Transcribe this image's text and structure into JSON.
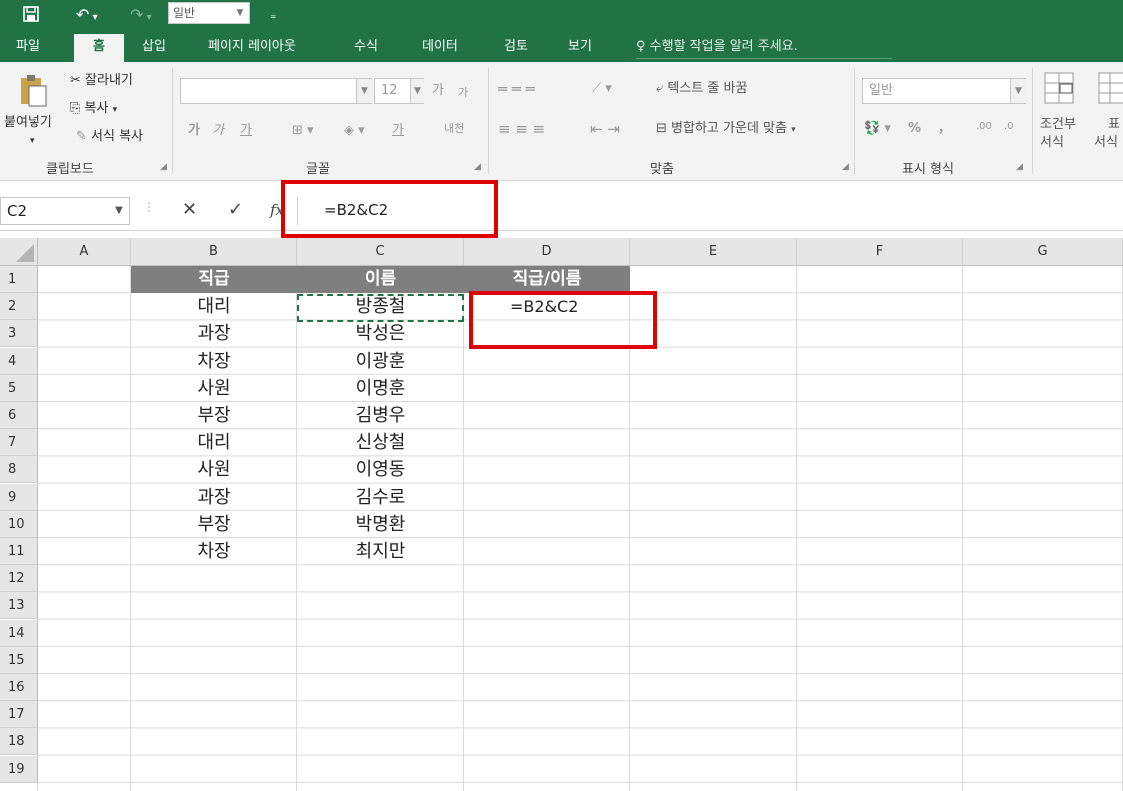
{
  "quick_access": {
    "font_box": "일반"
  },
  "tabs": [
    "파일",
    "홈",
    "삽입",
    "페이지 레이아웃",
    "수식",
    "데이터",
    "검토",
    "보기"
  ],
  "tell_me": "수행할 작업을 알려 주세요.",
  "ribbon": {
    "clipboard": {
      "cut": "잘라내기",
      "copy": "복사",
      "paste": "붙여넣기",
      "format_painter": "서식 복사",
      "label": "클립보드"
    },
    "font": {
      "size": "12",
      "grow": "가",
      "shrink": "가",
      "bold": "가",
      "italic": "가",
      "underline": "가",
      "font_color": "가",
      "phonetic": "내천",
      "label": "글꼴"
    },
    "alignment": {
      "wrap": "텍스트 줄 바꿈",
      "merge": "병합하고 가운데 맞춤",
      "label": "맞춤"
    },
    "number": {
      "format": "일반",
      "percent": "%",
      "comma": "，",
      "inc_decimal": ".00",
      "dec_decimal": ".0",
      "label": "표시 형식"
    },
    "styles": {
      "conditional": "조건부",
      "conditional_sub": "서식",
      "table": "표",
      "table_sub": "서식"
    }
  },
  "formula_bar": {
    "name_box": "C2",
    "cancel": "✕",
    "enter": "✓",
    "fx": "fx",
    "formula": "=B2&C2"
  },
  "columns": [
    "A",
    "B",
    "C",
    "D",
    "E",
    "F",
    "G"
  ],
  "rows": [
    "1",
    "2",
    "3",
    "4",
    "5",
    "6",
    "7",
    "8",
    "9",
    "10",
    "11",
    "12",
    "13",
    "14",
    "15",
    "16",
    "17",
    "18",
    "19"
  ],
  "header_row": {
    "b": "직급",
    "c": "이름",
    "d": "직급/이름"
  },
  "data": [
    {
      "b": "대리",
      "c": "방종철",
      "d": "=B2&C2"
    },
    {
      "b": "과장",
      "c": "박성은",
      "d": ""
    },
    {
      "b": "차장",
      "c": "이광훈",
      "d": ""
    },
    {
      "b": "사원",
      "c": "이명훈",
      "d": ""
    },
    {
      "b": "부장",
      "c": "김병우",
      "d": ""
    },
    {
      "b": "대리",
      "c": "신상철",
      "d": ""
    },
    {
      "b": "사원",
      "c": "이영동",
      "d": ""
    },
    {
      "b": "과장",
      "c": "김수로",
      "d": ""
    },
    {
      "b": "부장",
      "c": "박명환",
      "d": ""
    },
    {
      "b": "차장",
      "c": "최지만",
      "d": ""
    }
  ],
  "colors": {
    "excel_green": "#217346",
    "highlight_red": "#e00000",
    "header_fill": "#7f7f7f"
  }
}
